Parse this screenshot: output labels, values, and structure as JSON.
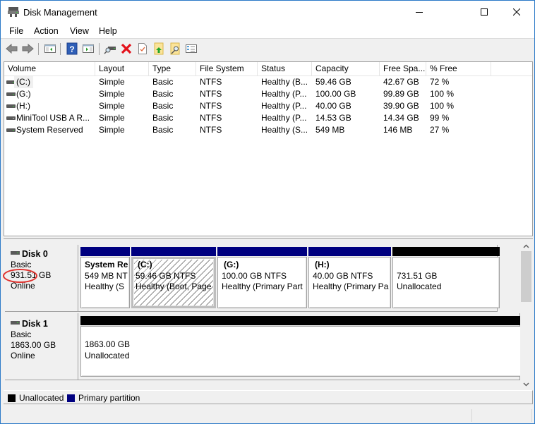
{
  "window": {
    "title": "Disk Management",
    "icon": "disk-management-icon",
    "controls": {
      "minimize": "minimize-icon",
      "maximize": "maximize-icon",
      "close": "close-icon"
    }
  },
  "menu": [
    "File",
    "Action",
    "View",
    "Help"
  ],
  "toolbar": [
    {
      "name": "back-button",
      "icon": "arrow-left-icon"
    },
    {
      "name": "forward-button",
      "icon": "arrow-right-icon"
    },
    {
      "name": "show-hide-console-tree-button",
      "icon": "console-tree-icon"
    },
    {
      "name": "help-button",
      "icon": "help-icon"
    },
    {
      "name": "show-hide-action-pane-button",
      "icon": "action-pane-icon"
    },
    {
      "name": "connect-virtual-disk-button",
      "icon": "connect-drive-icon"
    },
    {
      "name": "delete-button",
      "icon": "delete-x-icon"
    },
    {
      "name": "properties-button",
      "icon": "checkmark-page-icon"
    },
    {
      "name": "export-list-button",
      "icon": "folder-up-arrow-icon"
    },
    {
      "name": "search-button",
      "icon": "folder-magnifier-icon"
    },
    {
      "name": "settings-list-button",
      "icon": "checklist-icon"
    }
  ],
  "volume_list": {
    "columns": [
      "Volume",
      "Layout",
      "Type",
      "File System",
      "Status",
      "Capacity",
      "Free Spa...",
      "% Free"
    ],
    "rows": [
      {
        "volume": "(C:)",
        "layout": "Simple",
        "type": "Basic",
        "fs": "NTFS",
        "status": "Healthy (B...",
        "capacity": "59.46 GB",
        "free": "42.67 GB",
        "pct": "72 %",
        "icon": "volume-icon"
      },
      {
        "volume": "(G:)",
        "layout": "Simple",
        "type": "Basic",
        "fs": "NTFS",
        "status": "Healthy (P...",
        "capacity": "100.00 GB",
        "free": "99.89 GB",
        "pct": "100 %",
        "icon": "volume-icon"
      },
      {
        "volume": "(H:)",
        "layout": "Simple",
        "type": "Basic",
        "fs": "NTFS",
        "status": "Healthy (P...",
        "capacity": "40.00 GB",
        "free": "39.90 GB",
        "pct": "100 %",
        "icon": "volume-icon"
      },
      {
        "volume": "MiniTool USB A R...",
        "layout": "Simple",
        "type": "Basic",
        "fs": "NTFS",
        "status": "Healthy (P...",
        "capacity": "14.53 GB",
        "free": "14.34 GB",
        "pct": "99 %",
        "icon": "removable-volume-icon"
      },
      {
        "volume": "System Reserved",
        "layout": "Simple",
        "type": "Basic",
        "fs": "NTFS",
        "status": "Healthy (S...",
        "capacity": "549 MB",
        "free": "146 MB",
        "pct": "27 %",
        "icon": "volume-icon"
      }
    ]
  },
  "disks": [
    {
      "name": "Disk 0",
      "type": "Basic",
      "size_value": "931.51",
      "size_unit": "GB",
      "status": "Online",
      "partitions": [
        {
          "name": "System Re",
          "line2": "549 MB NT",
          "line3": "Healthy (S",
          "kind": "primary"
        },
        {
          "name": "(C:)",
          "line2": "59.46 GB NTFS",
          "line3": "Healthy (Boot, Page",
          "kind": "primary",
          "selected": true
        },
        {
          "name": "(G:)",
          "line2": "100.00 GB NTFS",
          "line3": "Healthy (Primary Part",
          "kind": "primary"
        },
        {
          "name": "(H:)",
          "line2": "40.00 GB NTFS",
          "line3": "Healthy (Primary Pa",
          "kind": "primary"
        },
        {
          "name": "",
          "line2": "731.51 GB",
          "line3": "Unallocated",
          "kind": "unallocated"
        }
      ]
    },
    {
      "name": "Disk 1",
      "type": "Basic",
      "size_value": "1863.00",
      "size_unit": "GB",
      "status": "Online",
      "partitions": [
        {
          "name": "",
          "line2": "1863.00 GB",
          "line3": "Unallocated",
          "kind": "unallocated"
        }
      ]
    }
  ],
  "legend": [
    {
      "label": "Unallocated",
      "color": "#000000"
    },
    {
      "label": "Primary partition",
      "color": "#000080"
    }
  ],
  "colors": {
    "primary_partition": "#000080",
    "unallocated": "#000000",
    "annotation_circle": "#e0322e",
    "window_border": "#2b79c8"
  }
}
